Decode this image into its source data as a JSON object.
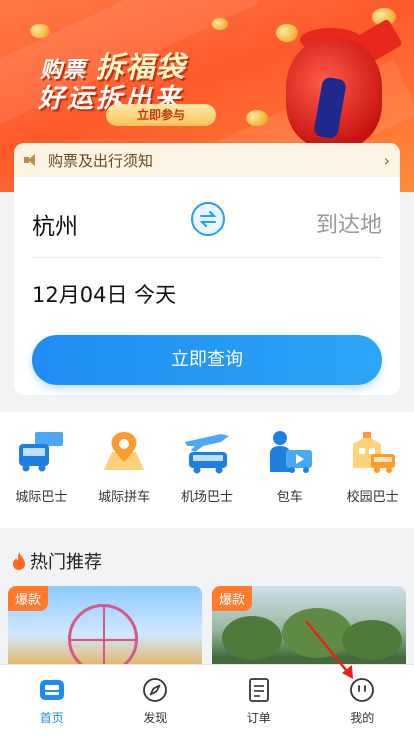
{
  "banner": {
    "line1_prefix": "购票",
    "line1_highlight": "拆福袋",
    "line2": "好运拆出来",
    "cta_label": "立即参与"
  },
  "notice": {
    "text": "购票及出行须知",
    "speaker_icon": "speaker-icon",
    "chevron": "›"
  },
  "search": {
    "from": "杭州",
    "to": "到达地",
    "swap_icon": "swap-icon",
    "date": "12月04日 今天",
    "query_label": "立即查询"
  },
  "services": [
    {
      "label": "城际巴士",
      "icon": "intercity-bus-icon"
    },
    {
      "label": "城际拼车",
      "icon": "intercity-carpool-icon"
    },
    {
      "label": "机场巴士",
      "icon": "airport-bus-icon"
    },
    {
      "label": "包车",
      "icon": "charter-car-icon"
    },
    {
      "label": "校园巴士",
      "icon": "campus-bus-icon"
    }
  ],
  "hot": {
    "title": "热门推荐",
    "cards": [
      {
        "tag": "爆款"
      },
      {
        "tag": "爆款"
      }
    ]
  },
  "tabs": [
    {
      "label": "首页",
      "icon": "home-icon",
      "active": true
    },
    {
      "label": "发现",
      "icon": "compass-icon",
      "active": false
    },
    {
      "label": "订单",
      "icon": "order-icon",
      "active": false
    },
    {
      "label": "我的",
      "icon": "profile-icon",
      "active": false
    }
  ],
  "colors": {
    "accent": "#1f8cf2",
    "banner": "#ff5a2c",
    "tag": "#ff7a2d",
    "notice_bg": "#fdf5e4"
  }
}
